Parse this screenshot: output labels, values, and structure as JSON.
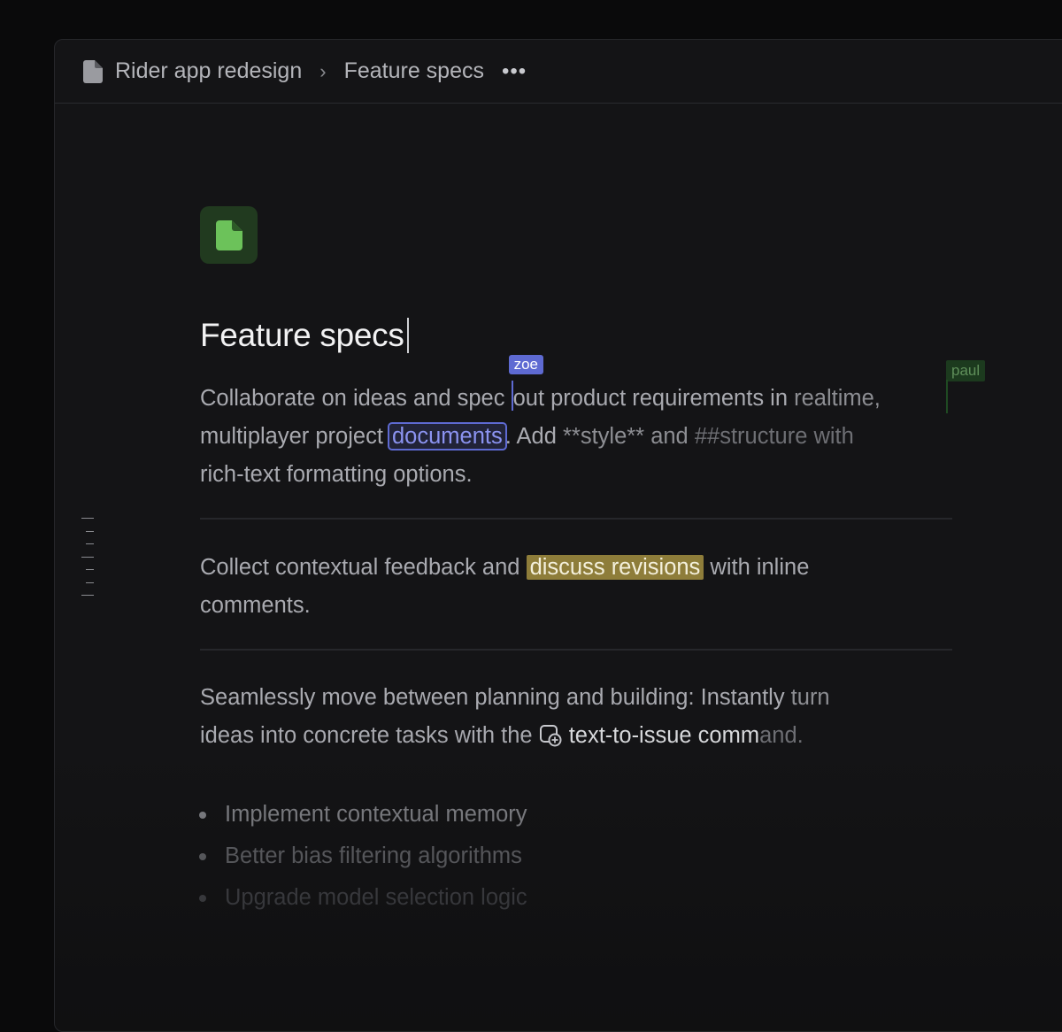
{
  "breadcrumb": {
    "project": "Rider app redesign",
    "separator": "›",
    "document": "Feature specs",
    "more": "•••"
  },
  "doc": {
    "title": "Feature specs",
    "p1": {
      "a": "Collaborate on ideas and spec ",
      "b": "out",
      "c": " product requirements in ",
      "d": "realtime,",
      "e": "multiplayer project ",
      "sel": "documents",
      "f": ". Add ",
      "g": "**style** and ",
      "h": "##structure with",
      "i": "rich-text formatting options."
    },
    "p2": {
      "a": "Collect contextual feedback and ",
      "highlight": "discuss revisions",
      "b": " with inline",
      "c": "comments."
    },
    "p3": {
      "a": "Seamlessly move between planning and building: Instantly ",
      "b": "turn",
      "c": "ideas into concrete tasks with the ",
      "cmd": "text-to-issue",
      "d": " comm",
      "e": "and."
    },
    "bullets": [
      "Implement contextual memory",
      "Better bias filtering algorithms",
      "Upgrade model selection logic"
    ]
  },
  "collaborators": {
    "zoe": "zoe",
    "paul": "paul"
  },
  "colors": {
    "accent": "#5e6ad2",
    "highlight": "#8e7d3a",
    "doc_icon": "#6cc25a",
    "paul": "#1c3a1e"
  },
  "icons": {
    "breadcrumb": "document-icon",
    "page": "document-icon",
    "command": "issue-command-icon"
  }
}
